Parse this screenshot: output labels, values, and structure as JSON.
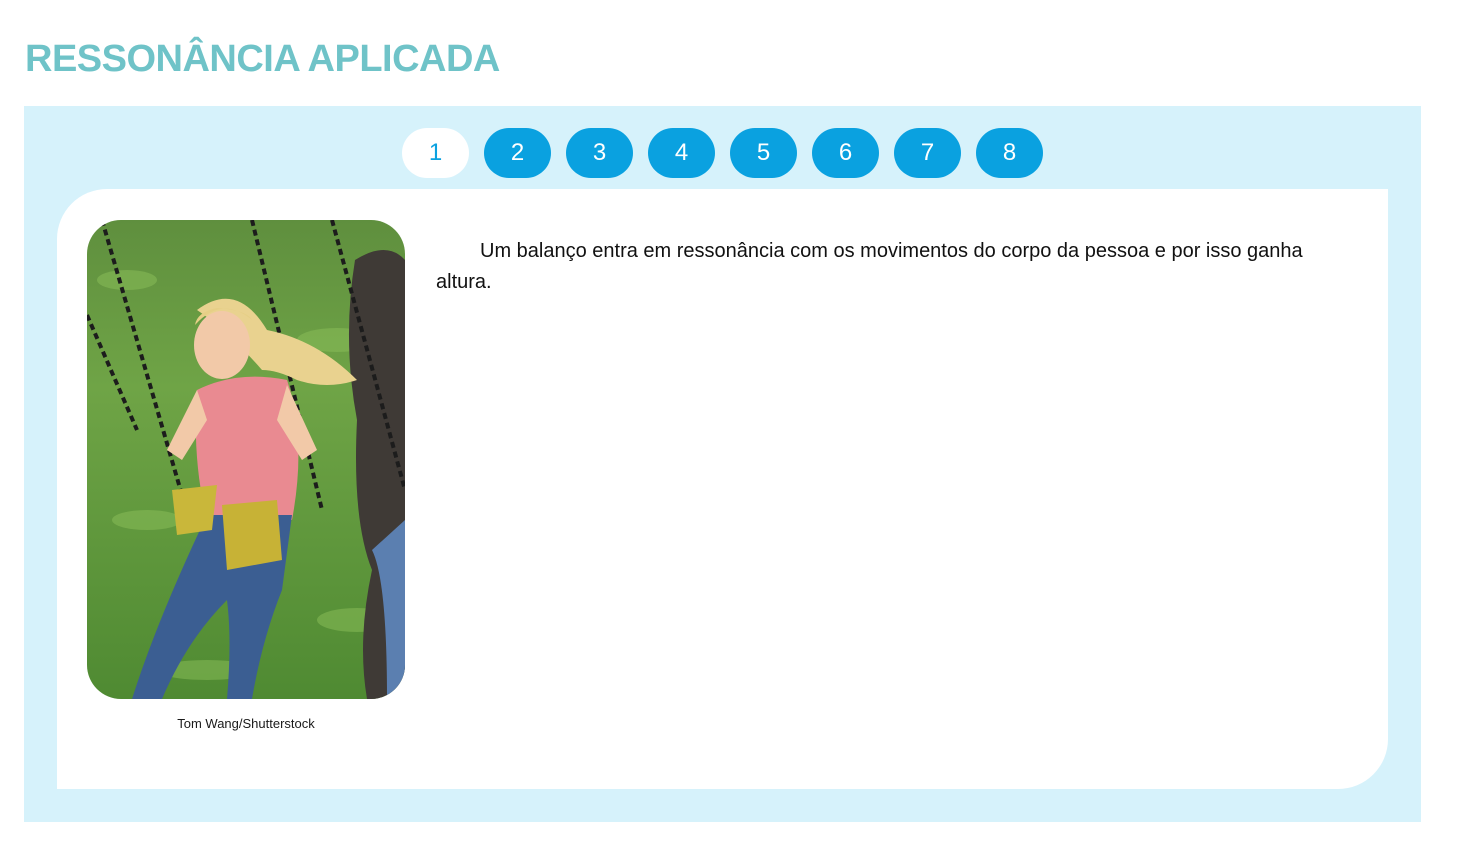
{
  "header": {
    "title": "RESSONÂNCIA APLICADA"
  },
  "pager": {
    "active_index": 0,
    "pages": [
      "1",
      "2",
      "3",
      "4",
      "5",
      "6",
      "7",
      "8"
    ]
  },
  "content": {
    "text": "Um balanço entra em ressonância com os movimentos do corpo da pessoa e por isso ganha altura.",
    "image_credit": "Tom Wang/Shutterstock"
  },
  "colors": {
    "title": "#6fc3c8",
    "panel_bg": "#d6f2fb",
    "page_button": "#0aa1e0",
    "page_button_active_bg": "#ffffff"
  }
}
